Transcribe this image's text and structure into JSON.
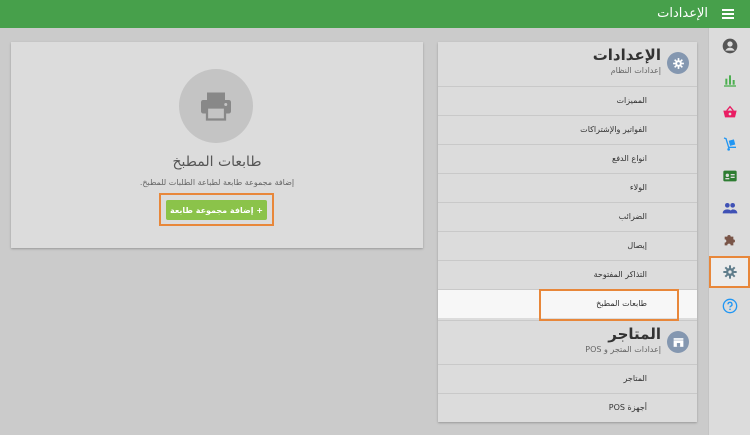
{
  "header": {
    "title": "الإعدادات",
    "menu_icon": "hamburger-menu-icon"
  },
  "rail": {
    "items": [
      {
        "icon": "account-circle-icon",
        "color": "#555555"
      },
      {
        "icon": "bar-chart-icon",
        "color": "#4caf50"
      },
      {
        "icon": "basket-icon",
        "color": "#e91e63"
      },
      {
        "icon": "dolly-icon",
        "color": "#2196f3"
      },
      {
        "icon": "contact-card-icon",
        "color": "#2e7d32"
      },
      {
        "icon": "people-icon",
        "color": "#3f51b5"
      },
      {
        "icon": "puzzle-icon",
        "color": "#795548"
      },
      {
        "icon": "gear-icon",
        "color": "#607d8b",
        "active": true
      },
      {
        "icon": "help-circle-icon",
        "color": "#2196f3"
      }
    ]
  },
  "settings": {
    "system": {
      "title": "الإعدادات",
      "subtitle": "إعدادات النظام",
      "items": [
        "المميزات",
        "الفواتير والإشتراكات",
        "انواع الدفع",
        "الولاء",
        "الضرائب",
        "إيصال",
        "التذاكر المفتوحة",
        "طابعات المطبخ"
      ]
    },
    "stores": {
      "title": "المتاجر",
      "subtitle": "إعدادات المتجر و POS",
      "items": [
        "المتاجر",
        "أجهزة POS"
      ]
    }
  },
  "card": {
    "title": "طابعات المطبخ",
    "description": "إضافة مجموعة طابعة لطباعة الطلبات للمطبخ.",
    "add_button": "+ إضافة مجموعة طابعة"
  },
  "colors": {
    "header": "#47a04b",
    "add_button": "#8bc34a",
    "highlight": "#e8873a"
  }
}
